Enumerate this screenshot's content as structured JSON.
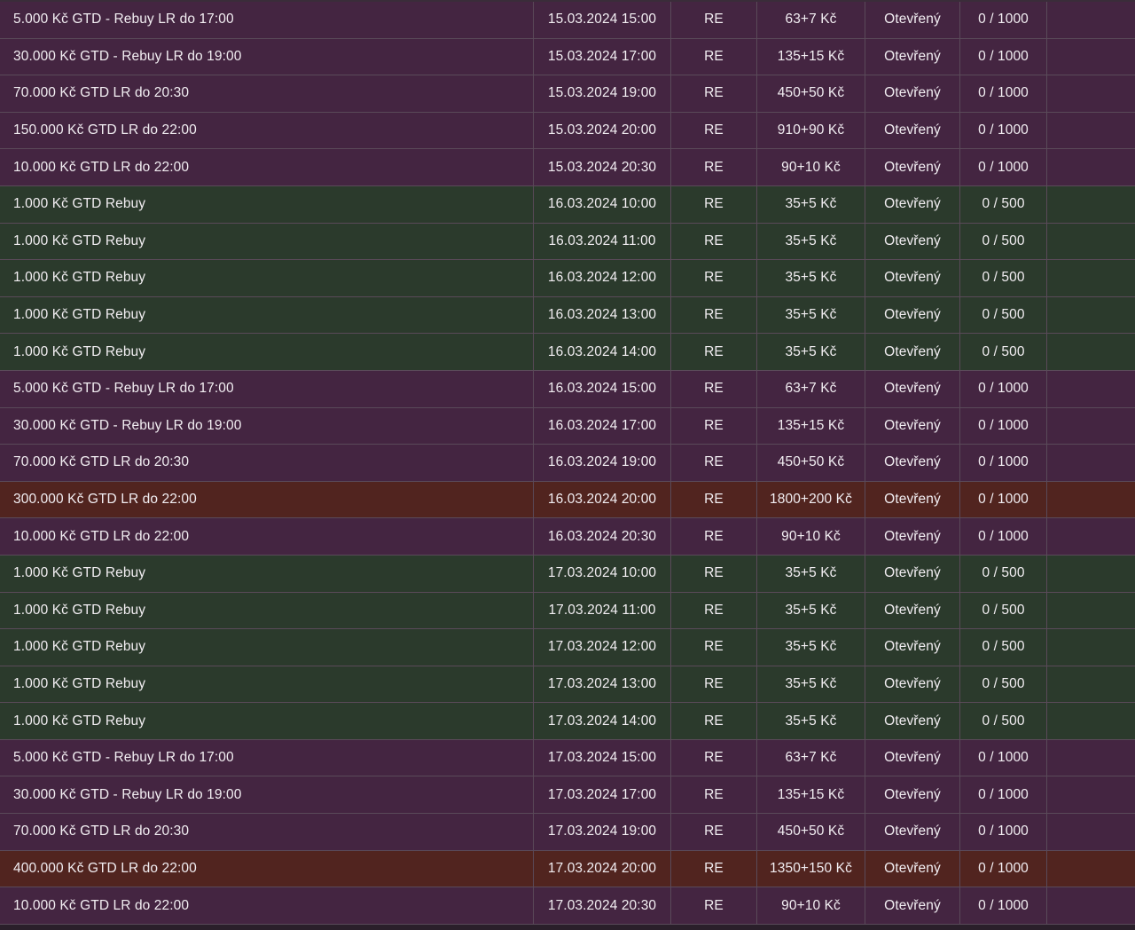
{
  "colors": {
    "purple_row": "#442541",
    "green_row": "#2b3a2c",
    "red_row": "#51241f",
    "divider": "#5a4a59",
    "text": "#f2eef2"
  },
  "rows": [
    {
      "name": "5.000 Kč GTD - Rebuy LR do 17:00",
      "date": "15.03.2024 15:00",
      "type": "RE",
      "buyin": "63+7 Kč",
      "status": "Otevřený",
      "seats": "0 / 1000",
      "color": "purple"
    },
    {
      "name": "30.000 Kč GTD - Rebuy LR do 19:00",
      "date": "15.03.2024 17:00",
      "type": "RE",
      "buyin": "135+15 Kč",
      "status": "Otevřený",
      "seats": "0 / 1000",
      "color": "purple"
    },
    {
      "name": "70.000 Kč GTD LR do 20:30",
      "date": "15.03.2024 19:00",
      "type": "RE",
      "buyin": "450+50 Kč",
      "status": "Otevřený",
      "seats": "0 / 1000",
      "color": "purple"
    },
    {
      "name": "150.000 Kč GTD LR do 22:00",
      "date": "15.03.2024 20:00",
      "type": "RE",
      "buyin": "910+90 Kč",
      "status": "Otevřený",
      "seats": "0 / 1000",
      "color": "purple"
    },
    {
      "name": "10.000 Kč GTD LR do 22:00",
      "date": "15.03.2024 20:30",
      "type": "RE",
      "buyin": "90+10 Kč",
      "status": "Otevřený",
      "seats": "0 / 1000",
      "color": "purple"
    },
    {
      "name": "1.000 Kč GTD Rebuy",
      "date": "16.03.2024 10:00",
      "type": "RE",
      "buyin": "35+5 Kč",
      "status": "Otevřený",
      "seats": "0 / 500",
      "color": "green"
    },
    {
      "name": "1.000 Kč GTD Rebuy",
      "date": "16.03.2024 11:00",
      "type": "RE",
      "buyin": "35+5 Kč",
      "status": "Otevřený",
      "seats": "0 / 500",
      "color": "green"
    },
    {
      "name": "1.000 Kč GTD Rebuy",
      "date": "16.03.2024 12:00",
      "type": "RE",
      "buyin": "35+5 Kč",
      "status": "Otevřený",
      "seats": "0 / 500",
      "color": "green"
    },
    {
      "name": "1.000 Kč GTD Rebuy",
      "date": "16.03.2024 13:00",
      "type": "RE",
      "buyin": "35+5 Kč",
      "status": "Otevřený",
      "seats": "0 / 500",
      "color": "green"
    },
    {
      "name": "1.000 Kč GTD Rebuy",
      "date": "16.03.2024 14:00",
      "type": "RE",
      "buyin": "35+5 Kč",
      "status": "Otevřený",
      "seats": "0 / 500",
      "color": "green"
    },
    {
      "name": "5.000 Kč GTD - Rebuy LR do 17:00",
      "date": "16.03.2024 15:00",
      "type": "RE",
      "buyin": "63+7 Kč",
      "status": "Otevřený",
      "seats": "0 / 1000",
      "color": "purple"
    },
    {
      "name": "30.000 Kč GTD - Rebuy LR do 19:00",
      "date": "16.03.2024 17:00",
      "type": "RE",
      "buyin": "135+15 Kč",
      "status": "Otevřený",
      "seats": "0 / 1000",
      "color": "purple"
    },
    {
      "name": "70.000 Kč GTD LR do 20:30",
      "date": "16.03.2024 19:00",
      "type": "RE",
      "buyin": "450+50 Kč",
      "status": "Otevřený",
      "seats": "0 / 1000",
      "color": "purple"
    },
    {
      "name": "300.000 Kč GTD LR do 22:00",
      "date": "16.03.2024 20:00",
      "type": "RE",
      "buyin": "1800+200 Kč",
      "status": "Otevřený",
      "seats": "0 / 1000",
      "color": "red"
    },
    {
      "name": "10.000 Kč GTD LR do 22:00",
      "date": "16.03.2024 20:30",
      "type": "RE",
      "buyin": "90+10 Kč",
      "status": "Otevřený",
      "seats": "0 / 1000",
      "color": "purple"
    },
    {
      "name": "1.000 Kč GTD Rebuy",
      "date": "17.03.2024 10:00",
      "type": "RE",
      "buyin": "35+5 Kč",
      "status": "Otevřený",
      "seats": "0 / 500",
      "color": "green"
    },
    {
      "name": "1.000 Kč GTD Rebuy",
      "date": "17.03.2024 11:00",
      "type": "RE",
      "buyin": "35+5 Kč",
      "status": "Otevřený",
      "seats": "0 / 500",
      "color": "green"
    },
    {
      "name": "1.000 Kč GTD Rebuy",
      "date": "17.03.2024 12:00",
      "type": "RE",
      "buyin": "35+5 Kč",
      "status": "Otevřený",
      "seats": "0 / 500",
      "color": "green"
    },
    {
      "name": "1.000 Kč GTD Rebuy",
      "date": "17.03.2024 13:00",
      "type": "RE",
      "buyin": "35+5 Kč",
      "status": "Otevřený",
      "seats": "0 / 500",
      "color": "green"
    },
    {
      "name": "1.000 Kč GTD Rebuy",
      "date": "17.03.2024 14:00",
      "type": "RE",
      "buyin": "35+5 Kč",
      "status": "Otevřený",
      "seats": "0 / 500",
      "color": "green"
    },
    {
      "name": "5.000 Kč GTD - Rebuy LR do 17:00",
      "date": "17.03.2024 15:00",
      "type": "RE",
      "buyin": "63+7 Kč",
      "status": "Otevřený",
      "seats": "0 / 1000",
      "color": "purple"
    },
    {
      "name": "30.000 Kč GTD - Rebuy LR do 19:00",
      "date": "17.03.2024 17:00",
      "type": "RE",
      "buyin": "135+15 Kč",
      "status": "Otevřený",
      "seats": "0 / 1000",
      "color": "purple"
    },
    {
      "name": "70.000 Kč GTD LR do 20:30",
      "date": "17.03.2024 19:00",
      "type": "RE",
      "buyin": "450+50 Kč",
      "status": "Otevřený",
      "seats": "0 / 1000",
      "color": "purple"
    },
    {
      "name": "400.000 Kč GTD LR do 22:00",
      "date": "17.03.2024 20:00",
      "type": "RE",
      "buyin": "1350+150 Kč",
      "status": "Otevřený",
      "seats": "0 / 1000",
      "color": "red"
    },
    {
      "name": "10.000 Kč GTD LR do 22:00",
      "date": "17.03.2024 20:30",
      "type": "RE",
      "buyin": "90+10 Kč",
      "status": "Otevřený",
      "seats": "0 / 1000",
      "color": "purple"
    }
  ]
}
